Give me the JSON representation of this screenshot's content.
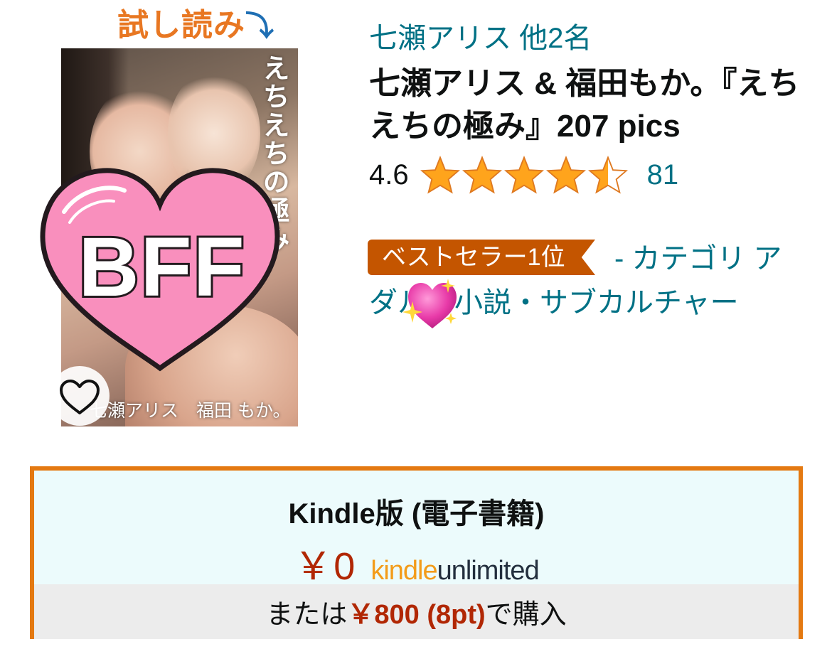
{
  "product": {
    "sample_label": "試し読み",
    "sample_arrow": "⤵",
    "cover": {
      "title_vertical": "えちえちの極み",
      "authors_line": "七瀬アリス　福田 もか。",
      "sticker_text": "BFF",
      "favorite_icon": "heart-outline-icon"
    },
    "author": "七瀬アリス 他2名",
    "title": "七瀬アリス & 福田もか。『えちえちの極み』207 pics",
    "rating": {
      "value": "4.6",
      "stars": 4.5,
      "count": "81"
    },
    "bestseller": {
      "badge": "ベストセラー1位",
      "category": "- カテゴリ アダルト小説・サブカルチャー",
      "sticker_icon": "sparkling-heart-icon"
    }
  },
  "buybox": {
    "format": "Kindle版 (電子書籍)",
    "price": "￥0",
    "ku_kindle": "kindle",
    "ku_unlimited": "unlimited",
    "alt_prefix": "または",
    "alt_price": "￥800 (8pt)",
    "alt_suffix": "で購入"
  },
  "colors": {
    "link": "#007185",
    "price": "#b12704",
    "badge": "#c45500",
    "buybox_border": "#e47911",
    "star": "#ffa41c"
  }
}
